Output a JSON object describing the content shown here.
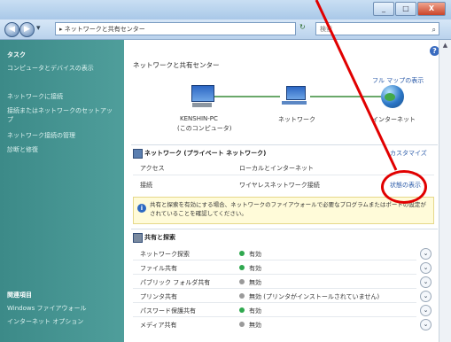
{
  "window": {
    "title": "",
    "buttons": [
      "_",
      "□",
      "X"
    ]
  },
  "addressbar": {
    "address": "▸ ネットワークと共有センター",
    "search_placeholder": "検索"
  },
  "sidebar": {
    "tasks_heading": "タスク",
    "items": [
      "コンピュータとデバイスの表示",
      "ネットワークに接続",
      "接続またはネットワークのセットアップ",
      "ネットワーク接続の管理",
      "診断と修復"
    ],
    "see_also_heading": "関連項目",
    "see_also_items": [
      "Windows ファイアウォール",
      "インターネット オプション"
    ]
  },
  "content": {
    "page_title": "ネットワークと共有センター",
    "full_map_link": "フル マップの表示",
    "computer_name": "KENSHIN-PC",
    "computer_label": "(このコンピュータ)",
    "network_label": "ネットワーク",
    "internet_label": "インターネット",
    "network_section_title": "ネットワーク (プライベート ネットワーク)",
    "customize_link": "カスタマイズ",
    "access_label": "アクセス",
    "access_value": "ローカルとインターネット",
    "connection_label": "接続",
    "connection_value": "ワイヤレスネットワーク接続",
    "status_link": "状態の表示",
    "info_text": "共有と探索を有効にする場合、ネットワークのファイアウォールで必要なプログラムまたはポートの設定がされていることを確認してください。",
    "sharing_section_title": "共有と探索",
    "sharing_rows": [
      {
        "label": "ネットワーク探索",
        "status": "有効",
        "color": "#2fa84f"
      },
      {
        "label": "ファイル共有",
        "status": "有効",
        "color": "#2fa84f"
      },
      {
        "label": "パブリック フォルダ共有",
        "status": "無効",
        "color": "#9a9a9a"
      },
      {
        "label": "プリンタ共有",
        "status": "無効 (プリンタがインストールされていません)",
        "color": "#9a9a9a"
      },
      {
        "label": "パスワード保護共有",
        "status": "有効",
        "color": "#2fa84f"
      },
      {
        "label": "メディア共有",
        "status": "無効",
        "color": "#9a9a9a"
      }
    ]
  }
}
